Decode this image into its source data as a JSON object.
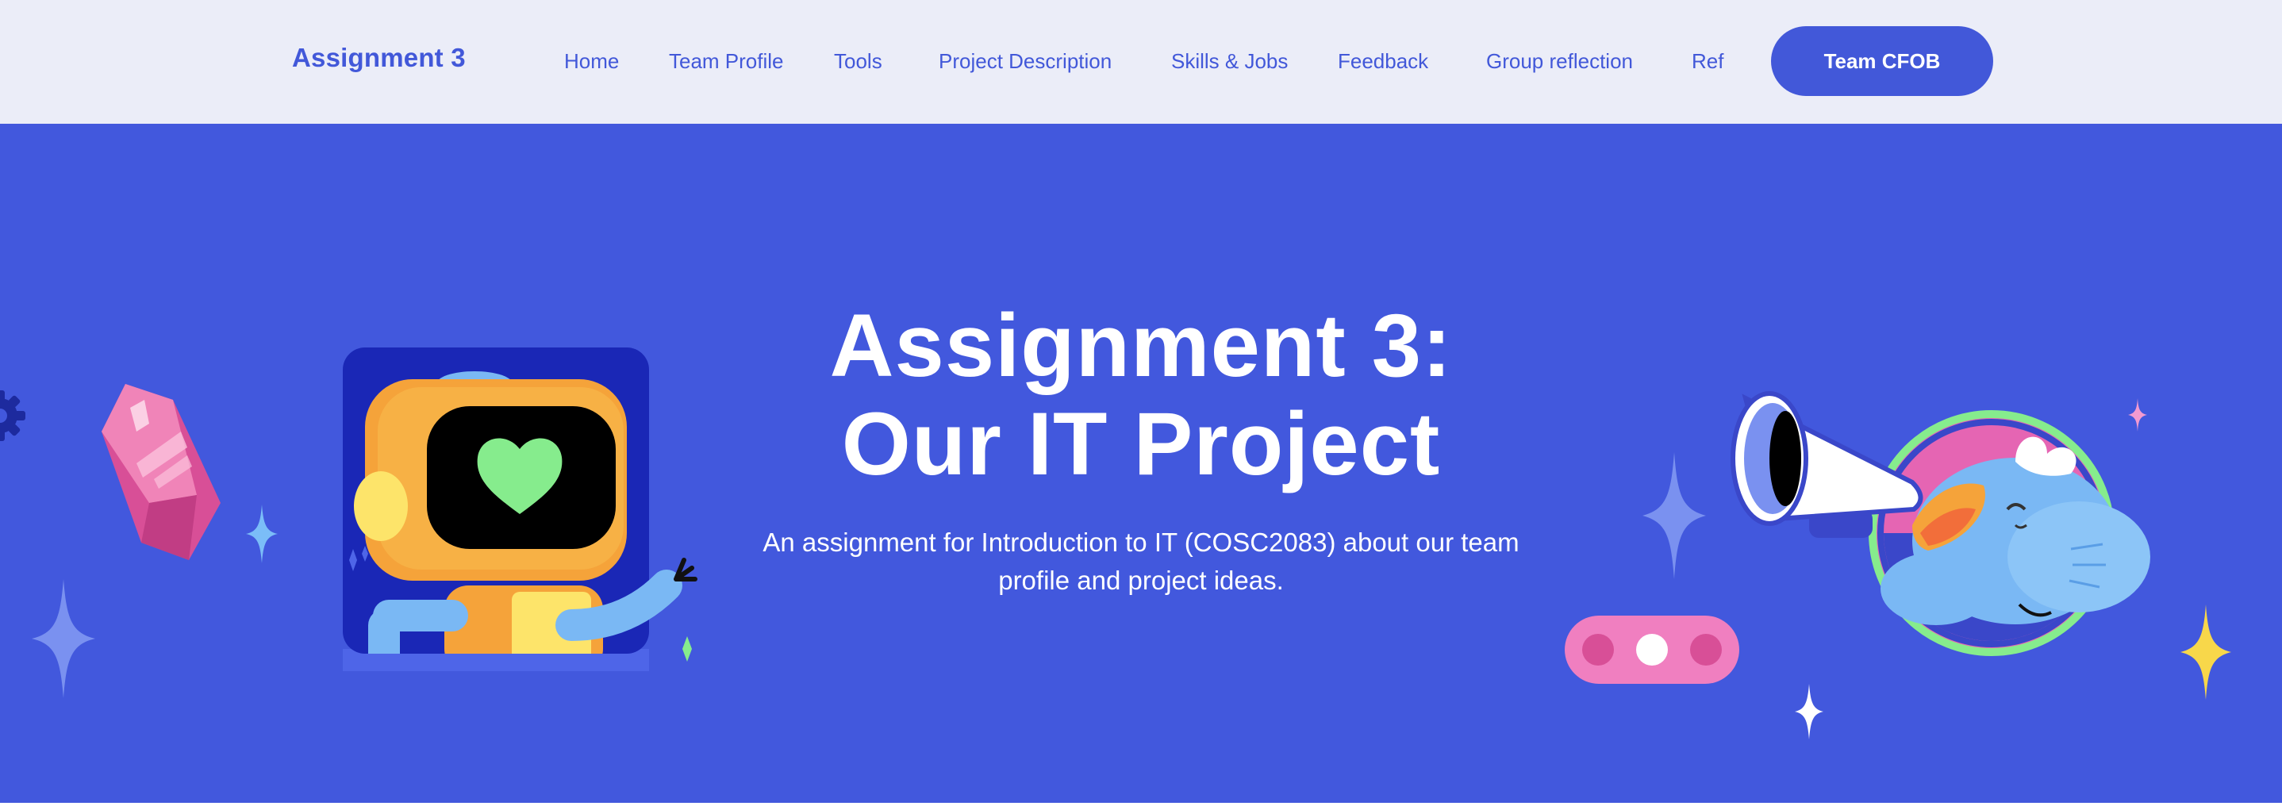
{
  "brand": {
    "label": "Assignment 3"
  },
  "nav": {
    "links": [
      "Home",
      "Team Profile",
      "Tools",
      "Project Description",
      "Skills & Jobs",
      "Feedback",
      "Group reflection",
      "Ref"
    ],
    "cta_label": "Team CFOB"
  },
  "hero": {
    "title_line1": "Assignment 3:",
    "title_line2": "Our IT Project",
    "subtitle": "An assignment for Introduction to IT (COSC2083) about our team profile and project ideas."
  },
  "colors": {
    "brand_blue": "#4258d9",
    "hero_bg": "#4258dd",
    "nav_bg": "#ebedf8"
  },
  "icons": {
    "illustrations": [
      "gear-icon",
      "gem-icon",
      "sparkle-icon",
      "robot-illustration",
      "chat-bubble-icon",
      "bird-megaphone-illustration"
    ]
  }
}
